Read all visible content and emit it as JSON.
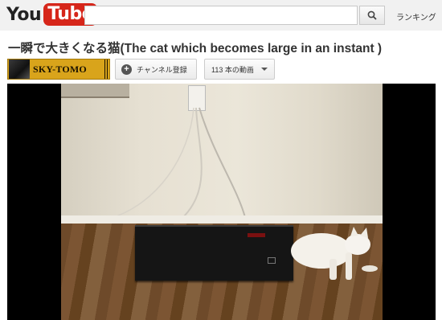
{
  "header": {
    "logo_you": "You",
    "logo_tube": "Tube",
    "search_placeholder": "",
    "ranking_label": "ランキング"
  },
  "video": {
    "title": "一瞬で大きくなる猫(The cat which becomes large in an instant )"
  },
  "channel": {
    "name": "SKY-TOMO",
    "subscribe_label": "チャンネル登録",
    "videos_label": "113 本の動画"
  },
  "colors": {
    "brand_red": "#d6261a",
    "channel_banner": "#d9a41b",
    "masthead_bg": "#f1f1f1"
  },
  "icons": {
    "search": "search-icon",
    "subscribe": "plus-icon",
    "videos_dropdown": "chevron-down-icon"
  }
}
